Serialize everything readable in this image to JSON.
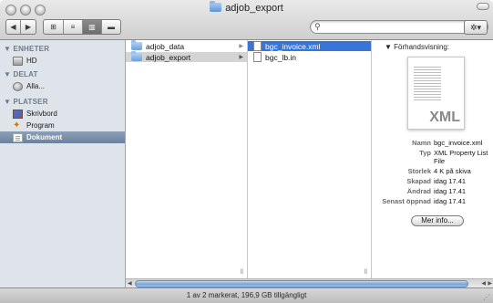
{
  "window": {
    "title": "adjob_export"
  },
  "toolbar": {
    "back_glyph": "◀",
    "forward_glyph": "▶",
    "view_icons_glyph": "⊞",
    "view_list_glyph": "≡",
    "view_columns_glyph": "▥",
    "view_coverflow_glyph": "▬",
    "search_placeholder": "",
    "search_glyph": "⚲",
    "action_glyph": "✲▾"
  },
  "sidebar": {
    "sections": [
      {
        "label": "▼ ENHETER",
        "items": [
          {
            "label": "HD",
            "icon": "hard-drive-icon"
          }
        ]
      },
      {
        "label": "▼ DELAT",
        "items": [
          {
            "label": "Alla...",
            "icon": "network-icon"
          }
        ]
      },
      {
        "label": "▼ PLATSER",
        "items": [
          {
            "label": "Skrivbord",
            "icon": "desktop-icon"
          },
          {
            "label": "Program",
            "icon": "applications-icon"
          },
          {
            "label": "Dokument",
            "icon": "documents-icon",
            "selected": true
          }
        ]
      }
    ]
  },
  "columns": [
    {
      "items": [
        {
          "label": "adjob_data",
          "kind": "folder",
          "chevron": "▶"
        },
        {
          "label": "adjob_export",
          "kind": "folder",
          "chevron": "▶",
          "selected": true
        }
      ]
    },
    {
      "items": [
        {
          "label": "bgc_invoice.xml",
          "kind": "file",
          "selected": true
        },
        {
          "label": "bgc_lb.in",
          "kind": "file"
        }
      ]
    }
  ],
  "preview": {
    "heading": "▼  Förhandsvisning:",
    "thumbnail_label": "XML",
    "meta": [
      {
        "key": "Namn",
        "value": "bgc_invoice.xml"
      },
      {
        "key": "Typ",
        "value": "XML Property List File"
      },
      {
        "key": "Storlek",
        "value": "4 K på skiva"
      },
      {
        "key": "Skapad",
        "value": "idag 17.41"
      },
      {
        "key": "Ändrad",
        "value": "idag 17.41"
      },
      {
        "key": "Senast öppnad",
        "value": "idag 17.41"
      }
    ],
    "more_info_label": "Mer info..."
  },
  "status_bar": {
    "text": "1 av 2 markerat, 196,9 GB tillgängligt"
  },
  "colors": {
    "selection_blue": "#3875d7",
    "sidebar_bg": "#dfe4ea",
    "sidebar_selected": "#6b819e"
  }
}
